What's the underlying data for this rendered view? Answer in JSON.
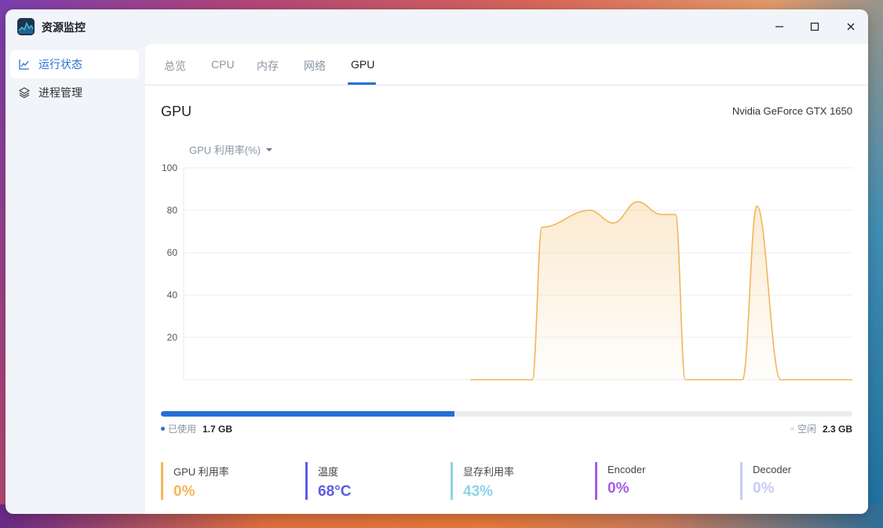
{
  "window": {
    "title": "资源监控"
  },
  "controls": {
    "minimize": "—",
    "maximize": "☐",
    "close": "✕"
  },
  "sidebar": {
    "items": [
      {
        "label": "运行状态",
        "icon": "line-chart-icon",
        "active": true
      },
      {
        "label": "进程管理",
        "icon": "layers-icon",
        "active": false
      }
    ]
  },
  "tabs": [
    "总览",
    "CPU",
    "内存",
    "网络",
    "GPU"
  ],
  "active_tab": "GPU",
  "section": {
    "title": "GPU",
    "model": "Nvidia GeForce GTX 1650"
  },
  "metric_selector": {
    "label": "GPU 利用率(%)"
  },
  "chart_data": {
    "type": "area",
    "y_ticks": [
      "100",
      "80",
      "60",
      "40",
      "20"
    ],
    "ylim": [
      0,
      100
    ],
    "grid": true,
    "color": "#f2b65a",
    "x": [
      -100,
      -40,
      -27,
      -25,
      -15,
      -10,
      -5,
      0,
      3,
      5,
      10,
      17,
      20,
      25,
      40
    ],
    "series": [
      {
        "values": [
          null,
          0,
          0,
          72,
          80,
          74,
          84,
          78,
          78,
          0,
          0,
          0,
          82,
          0,
          0
        ]
      }
    ],
    "xlim": [
      -100,
      40
    ]
  },
  "memory": {
    "used_label": "已使用",
    "used": "1.7 GB",
    "free_label": "空闲",
    "free": "2.3 GB",
    "used_fraction": 0.425
  },
  "stats": [
    {
      "label": "GPU 利用率",
      "value": "0%",
      "color": "#f2b65a"
    },
    {
      "label": "温度",
      "value": "68°C",
      "color": "#5a5ee0"
    },
    {
      "label": "显存利用率",
      "value": "43%",
      "color": "#8fd3e6"
    },
    {
      "label": "Encoder",
      "value": "0%",
      "color": "#a35de8"
    },
    {
      "label": "Decoder",
      "value": "0%",
      "color": "#c5ccf5"
    }
  ]
}
